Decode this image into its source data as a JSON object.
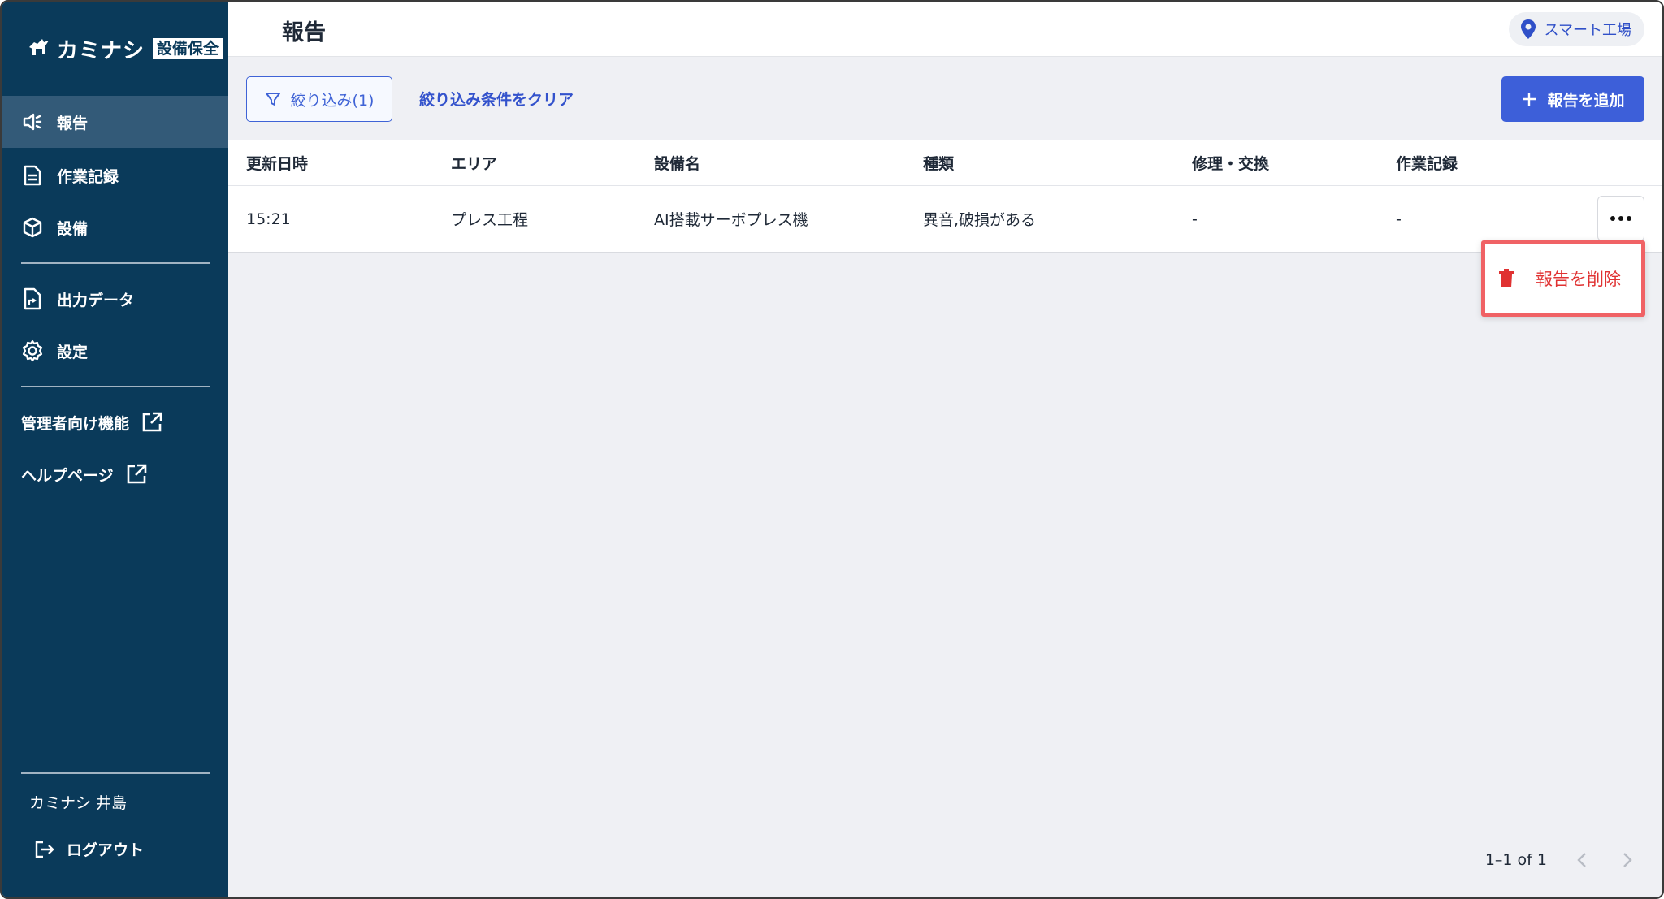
{
  "app": {
    "logo_text": "カミナシ",
    "logo_badge": "設備保全"
  },
  "sidebar": {
    "items": [
      {
        "label": "報告",
        "icon": "megaphone-icon",
        "active": true
      },
      {
        "label": "作業記録",
        "icon": "document-icon",
        "active": false
      },
      {
        "label": "設備",
        "icon": "cube-icon",
        "active": false
      },
      {
        "label": "出力データ",
        "icon": "file-export-icon",
        "active": false
      },
      {
        "label": "設定",
        "icon": "gear-icon",
        "active": false
      }
    ],
    "external_links": [
      {
        "label": "管理者向け機能",
        "icon": "external-link-icon"
      },
      {
        "label": "ヘルプページ",
        "icon": "external-link-icon"
      }
    ],
    "user_name": "カミナシ 井島",
    "logout_label": "ログアウト"
  },
  "header": {
    "title": "報告",
    "location": "スマート工場"
  },
  "toolbar": {
    "filter_label": "絞り込み(1)",
    "clear_label": "絞り込み条件をクリア",
    "add_label": "報告を追加"
  },
  "table": {
    "columns": [
      "更新日時",
      "エリア",
      "設備名",
      "種類",
      "修理・交換",
      "作業記録"
    ],
    "rows": [
      [
        "15:21",
        "プレス工程",
        "AI搭載サーボプレス機",
        "異音,破損がある",
        "-",
        "-"
      ]
    ]
  },
  "context_menu": {
    "delete_label": "報告を削除"
  },
  "pagination": {
    "range": "1–1 of 1"
  },
  "colors": {
    "sidebar_bg": "#0a3a5a",
    "sidebar_active": "#335a78",
    "accent": "#3d5fd9",
    "danger": "#e03232",
    "highlight_border": "#f06265"
  }
}
